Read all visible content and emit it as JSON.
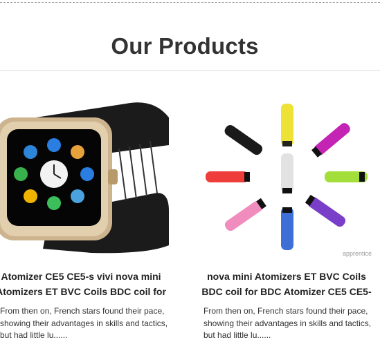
{
  "section": {
    "title": "Our Products"
  },
  "products": [
    {
      "name_line1": "Atomizer CE5 CE5-s vivi nova mini",
      "name_line2": "Atomizers ET BVC Coils BDC coil for",
      "description": "From then on, French stars found their pace, showing their advantages in skills and tactics, but had little lu......",
      "image_icon": "smartwatch-icon"
    },
    {
      "name_line1": "nova mini Atomizers ET BVC Coils",
      "name_line2": "BDC coil for BDC Atomizer CE5 CE5-",
      "description": "From then on, French stars found their pace, showing their advantages in skills and tactics, but had little lu......",
      "image_icon": "drip-tips-icon",
      "image_watermark": "apprentice"
    }
  ]
}
